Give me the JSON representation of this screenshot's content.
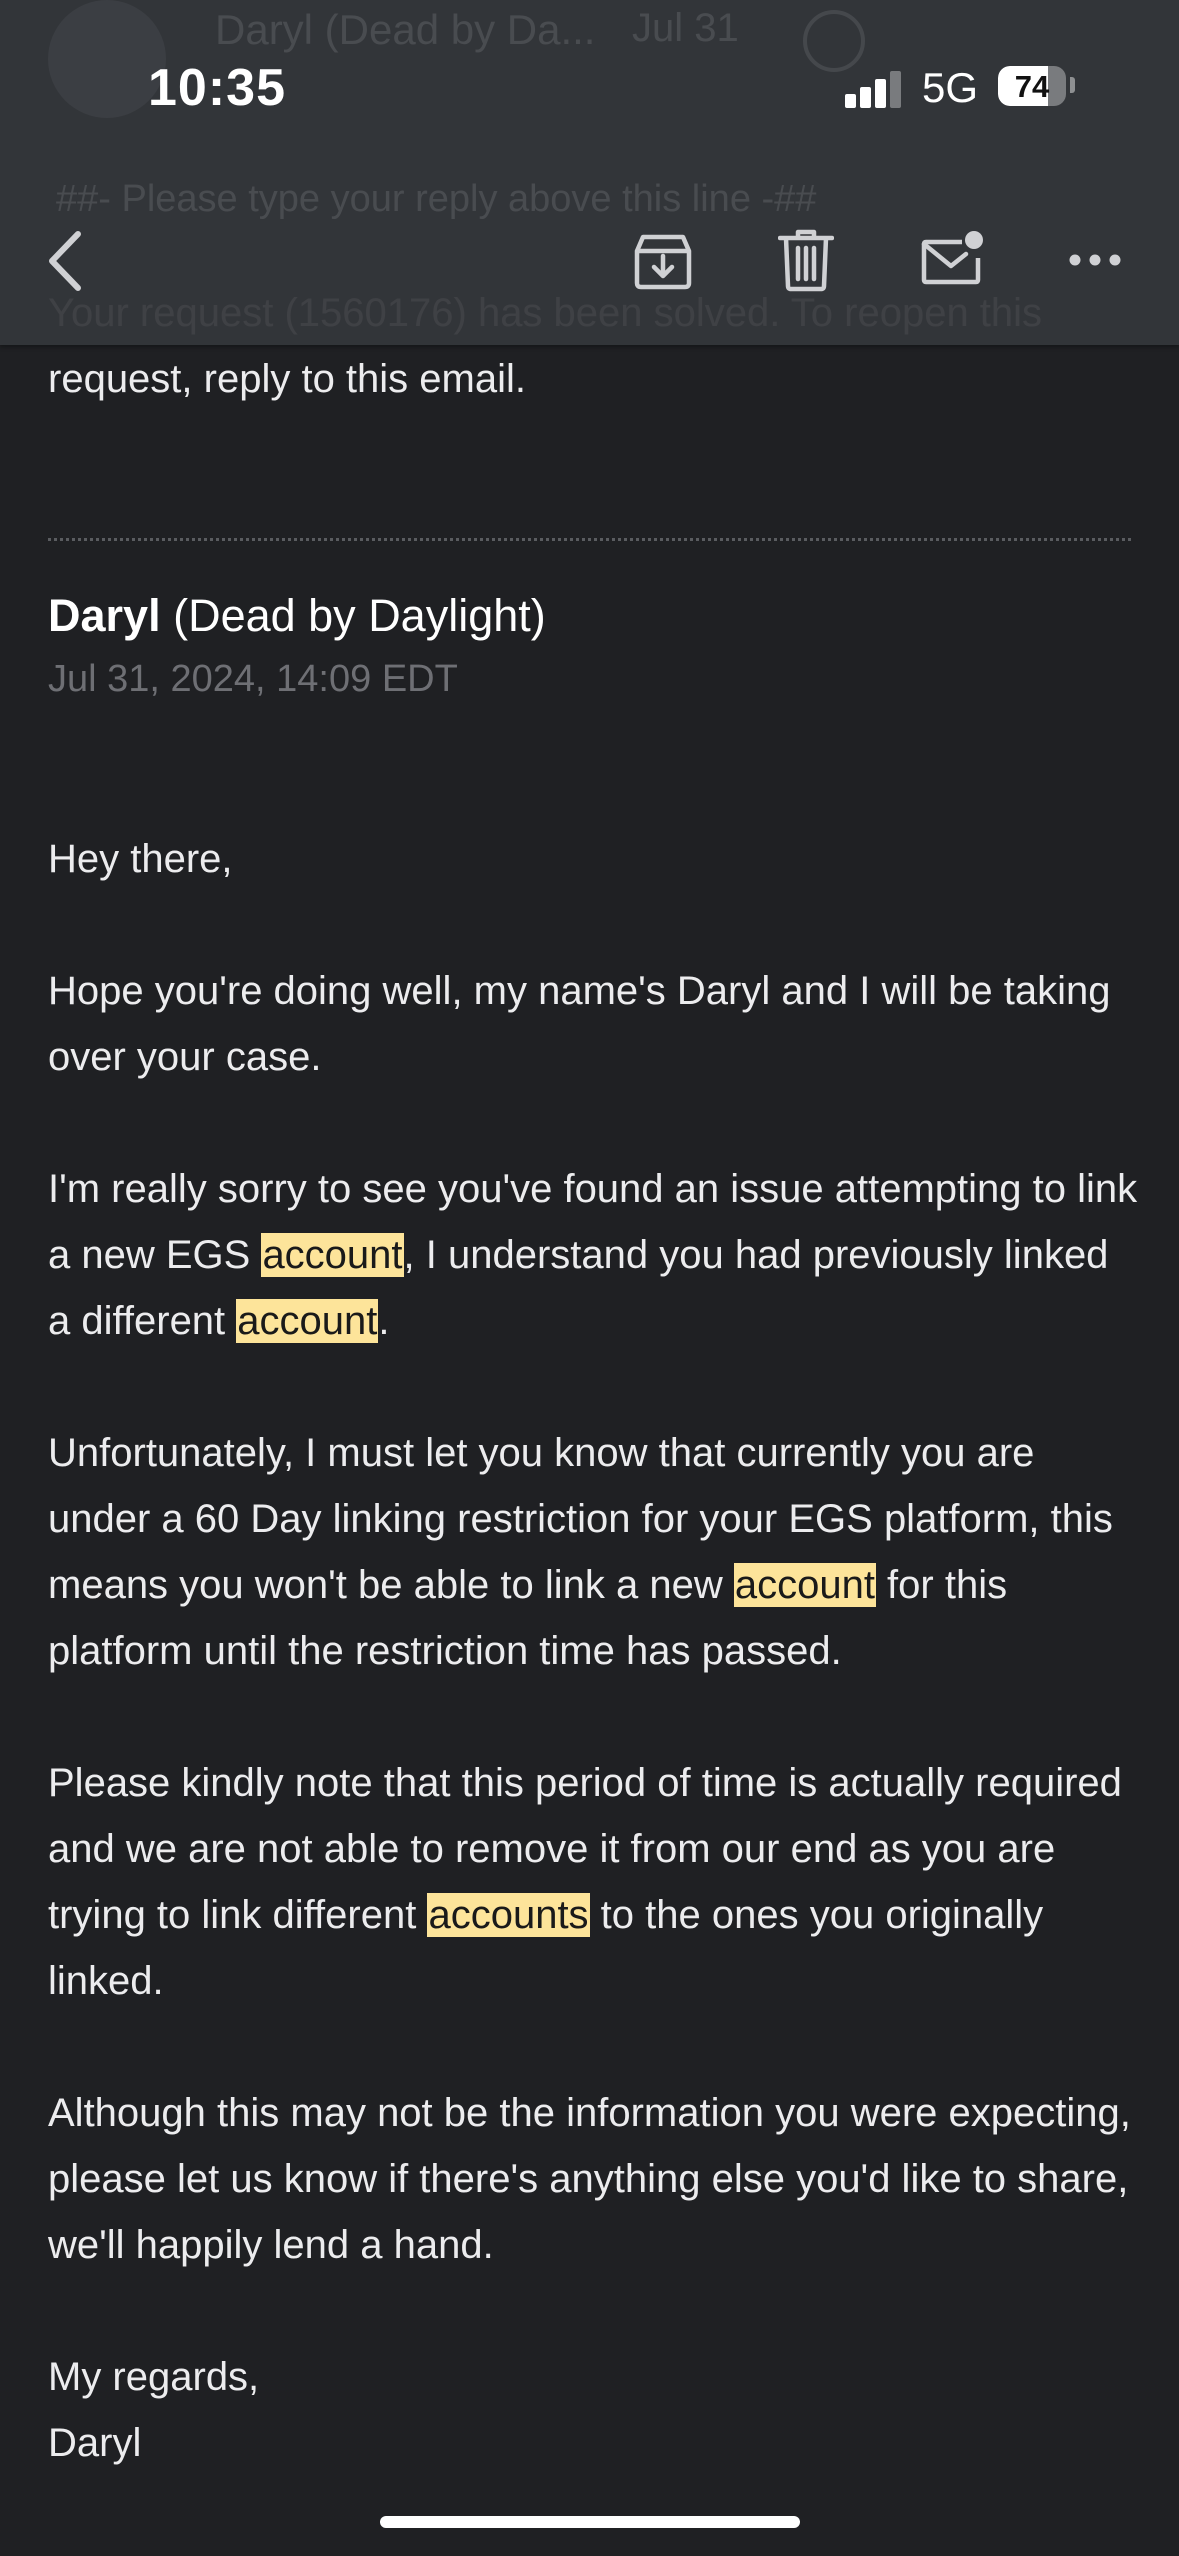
{
  "status_bar": {
    "time": "10:35",
    "network": "5G",
    "battery_percent": "74",
    "signal_bars_active": 3,
    "signal_bars_total": 4
  },
  "toolbar": {
    "back_icon": "chevron-left-icon",
    "archive_icon": "archive-icon",
    "trash_icon": "trash-icon",
    "mark_unread_icon": "envelope-dot-icon",
    "more_icon": "more-horizontal-icon"
  },
  "underlying_header": {
    "sender": "Daryl (Dead by Da...",
    "date": "Jul 31",
    "line": "##- Please type your reply above this line -##"
  },
  "previous_message": {
    "text": "Your request (1560176) has been solved. To reopen this request, reply to this email."
  },
  "message": {
    "sender_name": "Daryl",
    "sender_org": "(Dead by Daylight)",
    "date": "Jul 31, 2024, 14:09 EDT",
    "greeting": "Hey there,",
    "p1": "Hope you're doing well, my name's Daryl and I will be taking over your case.",
    "p2": {
      "a": "I'm really sorry to see you've found an issue attempting to link a new EGS ",
      "hl1": "account",
      "b": ", I understand you had previously linked a different ",
      "hl2": "account",
      "c": "."
    },
    "p3": {
      "a": "Unfortunately, I must let you know that currently you are under a 60 Day linking restriction for your EGS platform, this means you won't be able to link a new ",
      "hl1": "account",
      "b": " for this platform until the restriction time has passed."
    },
    "p4": {
      "a": "Please kindly note that this period of time is actually required and we are not able to remove it from our end as you are trying to link different ",
      "hl1": "accounts",
      "b": " to the ones you originally linked."
    },
    "p5": "Although this may not be the information you were expecting, please let us know if there's anything else you'd like to share, we'll happily lend a hand.",
    "signoff": "My regards,",
    "signature": "Daryl"
  },
  "colors": {
    "background": "#1f2023",
    "toolbar": "#34363a",
    "text": "#ececee",
    "date_text": "#6e6f74",
    "highlight": "#fde49a"
  }
}
